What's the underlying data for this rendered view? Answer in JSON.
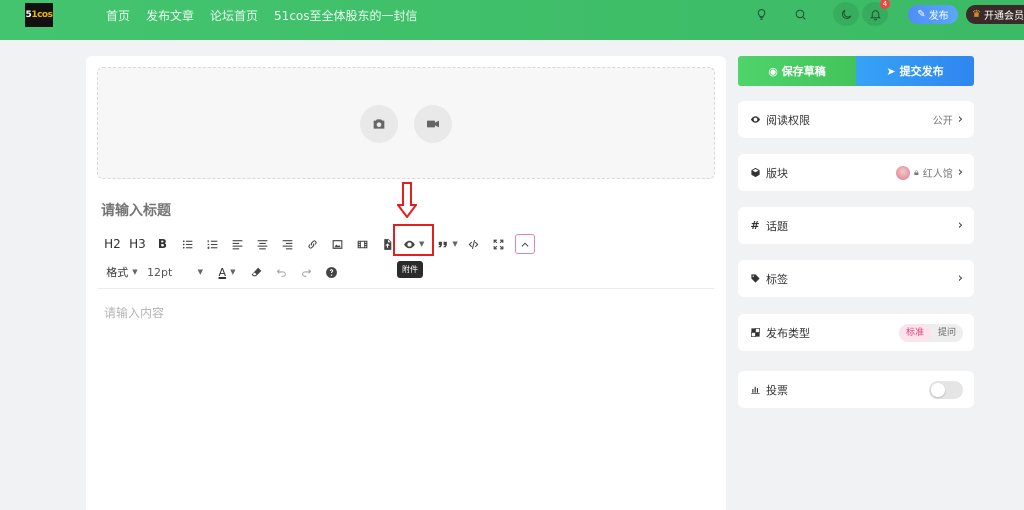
{
  "header": {
    "logo_text": "51cos",
    "nav": [
      "首页",
      "发布文章",
      "论坛首页",
      "51cos至全体股东的一封信"
    ],
    "notif_count": "4",
    "publish_label": "发布",
    "vip_label": "开通会员"
  },
  "editor": {
    "title_placeholder": "请输入标题",
    "content_placeholder": "请输入内容",
    "toolbar": {
      "h2": "H2",
      "h3": "H3",
      "bold": "B",
      "format_label": "格式",
      "font_size": "12pt",
      "font_color_label": "A"
    },
    "tooltip": "附件"
  },
  "sidebar": {
    "save_label": "保存草稿",
    "submit_label": "提交发布",
    "read_permission": {
      "label": "阅读权限",
      "value": "公开"
    },
    "forum": {
      "label": "版块",
      "value": "红人馆"
    },
    "topic": {
      "label": "话题"
    },
    "tags": {
      "label": "标签"
    },
    "publish_type": {
      "label": "发布类型",
      "options": [
        "标准",
        "提问"
      ],
      "selected": "标准"
    },
    "vote": {
      "label": "投票",
      "enabled": false
    }
  },
  "colors": {
    "header_green": "#44c46e",
    "save_green": "#4fd36b",
    "submit_blue": "#2f86ef",
    "annotation_red": "#e02020",
    "accent_pink": "#e2447c"
  }
}
